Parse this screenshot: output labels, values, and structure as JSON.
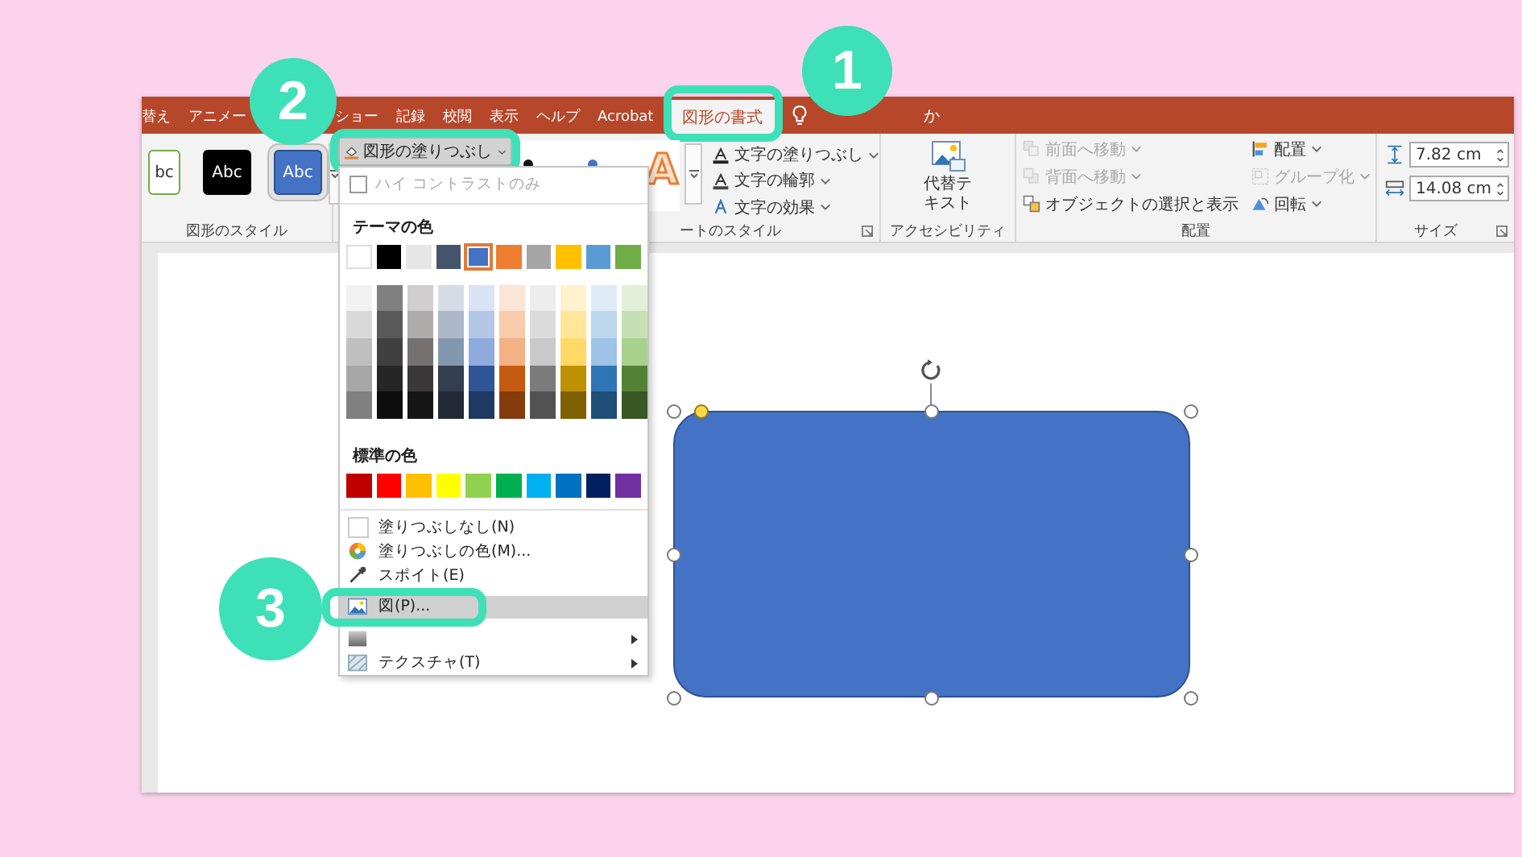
{
  "tabs": [
    {
      "label": "替え",
      "selected": false
    },
    {
      "label": "アニメー",
      "selected": false
    },
    {
      "label": "ショー",
      "selected": false
    },
    {
      "label": "記録",
      "selected": false
    },
    {
      "label": "校閲",
      "selected": false
    },
    {
      "label": "表示",
      "selected": false
    },
    {
      "label": "ヘルプ",
      "selected": false
    },
    {
      "label": "Acrobat",
      "selected": false
    },
    {
      "label": "図形の書式",
      "selected": true
    }
  ],
  "tell_me": {
    "text": "か"
  },
  "ribbon": {
    "shape_styles": {
      "swatches": [
        {
          "label": "bc",
          "kind": "white",
          "selected": false
        },
        {
          "label": "Abc",
          "kind": "black",
          "selected": false
        },
        {
          "label": "Abc",
          "kind": "blue",
          "selected": true
        }
      ],
      "group_label": "図形のスタイル"
    },
    "fill_button": {
      "label": "図形の塗りつぶし"
    },
    "wordart": {
      "preview": "A",
      "commands": [
        {
          "kind": "text-fill",
          "label": "文字の塗りつぶし"
        },
        {
          "kind": "text-outline",
          "label": "文字の輪郭"
        },
        {
          "kind": "text-effects",
          "label": "文字の効果"
        }
      ],
      "group_label": "ートのスタイル"
    },
    "accessibility": {
      "lines": [
        "代替テ",
        "キスト"
      ],
      "group_label": "アクセシビリティ"
    },
    "arrange": {
      "commands": [
        {
          "kind": "forward",
          "label": "前面へ移動",
          "disabled": true,
          "dropdown": true
        },
        {
          "kind": "backward",
          "label": "背面へ移動",
          "disabled": true,
          "dropdown": true
        },
        {
          "kind": "selection",
          "label": "オブジェクトの選択と表示",
          "disabled": false,
          "dropdown": false
        },
        {
          "kind": "align",
          "label": "配置",
          "disabled": false,
          "dropdown": true
        },
        {
          "kind": "group",
          "label": "グループ化",
          "disabled": true,
          "dropdown": true
        },
        {
          "kind": "rotate",
          "label": "回転",
          "disabled": false,
          "dropdown": true
        }
      ],
      "group_label": "配置"
    },
    "size": {
      "fields": [
        {
          "kind": "height",
          "value": "7.82 cm"
        },
        {
          "kind": "width",
          "value": "14.08 cm"
        }
      ],
      "group_label": "サイズ"
    }
  },
  "fill_menu": {
    "high_contrast": {
      "label": "ハイ コントラストのみ",
      "checked": false,
      "disabled": true
    },
    "theme_heading": "テーマの色",
    "theme_colors": [
      {
        "color": "#ffffff",
        "selected": false
      },
      {
        "color": "#000000",
        "selected": false
      },
      {
        "color": "#e7e6e6",
        "selected": false
      },
      {
        "color": "#44546a",
        "selected": false
      },
      {
        "color": "#4472c4",
        "selected": true
      },
      {
        "color": "#ed7d31",
        "selected": false
      },
      {
        "color": "#a5a5a5",
        "selected": false
      },
      {
        "color": "#ffc000",
        "selected": false
      },
      {
        "color": "#5b9bd5",
        "selected": false
      },
      {
        "color": "#70ad47",
        "selected": false
      }
    ],
    "shade_columns": [
      {
        "shades": [
          {
            "color": "#f2f2f2"
          },
          {
            "color": "#d9d9d9"
          },
          {
            "color": "#bfbfbf"
          },
          {
            "color": "#a6a6a6"
          },
          {
            "color": "#808080"
          }
        ]
      },
      {
        "shades": [
          {
            "color": "#808080"
          },
          {
            "color": "#595959"
          },
          {
            "color": "#404040"
          },
          {
            "color": "#262626"
          },
          {
            "color": "#0d0d0d"
          }
        ]
      },
      {
        "shades": [
          {
            "color": "#d0cece"
          },
          {
            "color": "#aeabab"
          },
          {
            "color": "#757171"
          },
          {
            "color": "#3a3838"
          },
          {
            "color": "#171616"
          }
        ]
      },
      {
        "shades": [
          {
            "color": "#d6dce5"
          },
          {
            "color": "#adb9ca"
          },
          {
            "color": "#8497b0"
          },
          {
            "color": "#333f50"
          },
          {
            "color": "#222a35"
          }
        ]
      },
      {
        "shades": [
          {
            "color": "#dae3f3"
          },
          {
            "color": "#b4c7e7"
          },
          {
            "color": "#8faadc"
          },
          {
            "color": "#2f5597"
          },
          {
            "color": "#203864"
          }
        ]
      },
      {
        "shades": [
          {
            "color": "#fbe5d6"
          },
          {
            "color": "#f8cbad"
          },
          {
            "color": "#f4b183"
          },
          {
            "color": "#c55a11"
          },
          {
            "color": "#843c0c"
          }
        ]
      },
      {
        "shades": [
          {
            "color": "#ededed"
          },
          {
            "color": "#dbdbdb"
          },
          {
            "color": "#c9c9c9"
          },
          {
            "color": "#7b7b7b"
          },
          {
            "color": "#525252"
          }
        ]
      },
      {
        "shades": [
          {
            "color": "#fff2cc"
          },
          {
            "color": "#ffe699"
          },
          {
            "color": "#ffd966"
          },
          {
            "color": "#bf9000"
          },
          {
            "color": "#7f6000"
          }
        ]
      },
      {
        "shades": [
          {
            "color": "#deebf7"
          },
          {
            "color": "#bdd7ee"
          },
          {
            "color": "#9dc3e6"
          },
          {
            "color": "#2e75b6"
          },
          {
            "color": "#1f4e79"
          }
        ]
      },
      {
        "shades": [
          {
            "color": "#e2f0d9"
          },
          {
            "color": "#c5e0b4"
          },
          {
            "color": "#a9d18e"
          },
          {
            "color": "#548235"
          },
          {
            "color": "#385723"
          }
        ]
      }
    ],
    "standard_heading": "標準の色",
    "standard_colors": [
      {
        "color": "#c00000"
      },
      {
        "color": "#ff0000"
      },
      {
        "color": "#ffc000"
      },
      {
        "color": "#ffff00"
      },
      {
        "color": "#92d050"
      },
      {
        "color": "#00b050"
      },
      {
        "color": "#00b0f0"
      },
      {
        "color": "#0070c0"
      },
      {
        "color": "#002060"
      },
      {
        "color": "#7030a0"
      }
    ],
    "items": [
      {
        "kind": "no-fill",
        "label": "塗りつぶしなし(N)",
        "highlighted": false,
        "submenu": false
      },
      {
        "kind": "palette",
        "label": "塗りつぶしの色(M)...",
        "highlighted": false,
        "submenu": false
      },
      {
        "kind": "eyedropper",
        "label": "スポイト(E)",
        "highlighted": false,
        "submenu": false
      },
      {
        "kind": "picture",
        "label": "図(P)...",
        "highlighted": true,
        "submenu": false
      },
      {
        "kind": "gradient",
        "highlighted": false,
        "submenu": true
      },
      {
        "kind": "texture",
        "label": "テクスチャ(T)",
        "highlighted": false,
        "submenu": true
      }
    ]
  },
  "annotations": [
    {
      "number": "1"
    },
    {
      "number": "2"
    },
    {
      "number": "3"
    }
  ]
}
